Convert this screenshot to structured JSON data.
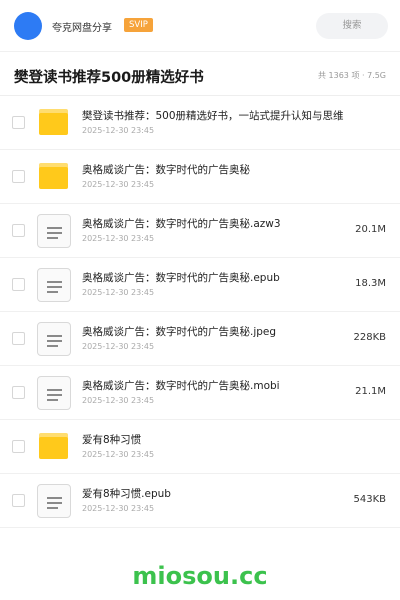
{
  "header": {
    "brand": "夸克网盘分享",
    "badge": "SVIP",
    "search_placeholder": "搜索"
  },
  "page": {
    "title": "樊登读书推荐500册精选好书",
    "summary": "共 1363 项 · 7.5G"
  },
  "files": [
    {
      "name": "樊登读书推荐：500册精选好书，一站式提升认知与思维",
      "date": "2025-12-30 23:45",
      "size": "",
      "icon": "folder-icon"
    },
    {
      "name": "奥格威谈广告：数字时代的广告奥秘",
      "date": "2025-12-30 23:45",
      "size": "",
      "icon": "folder-icon"
    },
    {
      "name": "奥格威谈广告：数字时代的广告奥秘.azw3",
      "date": "2025-12-30 23:45",
      "size": "20.1M",
      "icon": "document-icon"
    },
    {
      "name": "奥格威谈广告：数字时代的广告奥秘.epub",
      "date": "2025-12-30 23:45",
      "size": "18.3M",
      "icon": "document-icon"
    },
    {
      "name": "奥格威谈广告：数字时代的广告奥秘.jpeg",
      "date": "2025-12-30 23:45",
      "size": "228KB",
      "icon": "document-icon"
    },
    {
      "name": "奥格威谈广告：数字时代的广告奥秘.mobi",
      "date": "2025-12-30 23:45",
      "size": "21.1M",
      "icon": "document-icon"
    },
    {
      "name": "爱有8种习惯",
      "date": "2025-12-30 23:45",
      "size": "",
      "icon": "folder-icon"
    },
    {
      "name": "爱有8种习惯.epub",
      "date": "2025-12-30 23:45",
      "size": "543KB",
      "icon": "document-icon"
    }
  ],
  "watermark": "miosou.cc",
  "colors": {
    "avatar": "#2d7bf4",
    "badge": "#f6a33a",
    "folder": "#ffc91b",
    "watermark": "#3cc24d"
  }
}
